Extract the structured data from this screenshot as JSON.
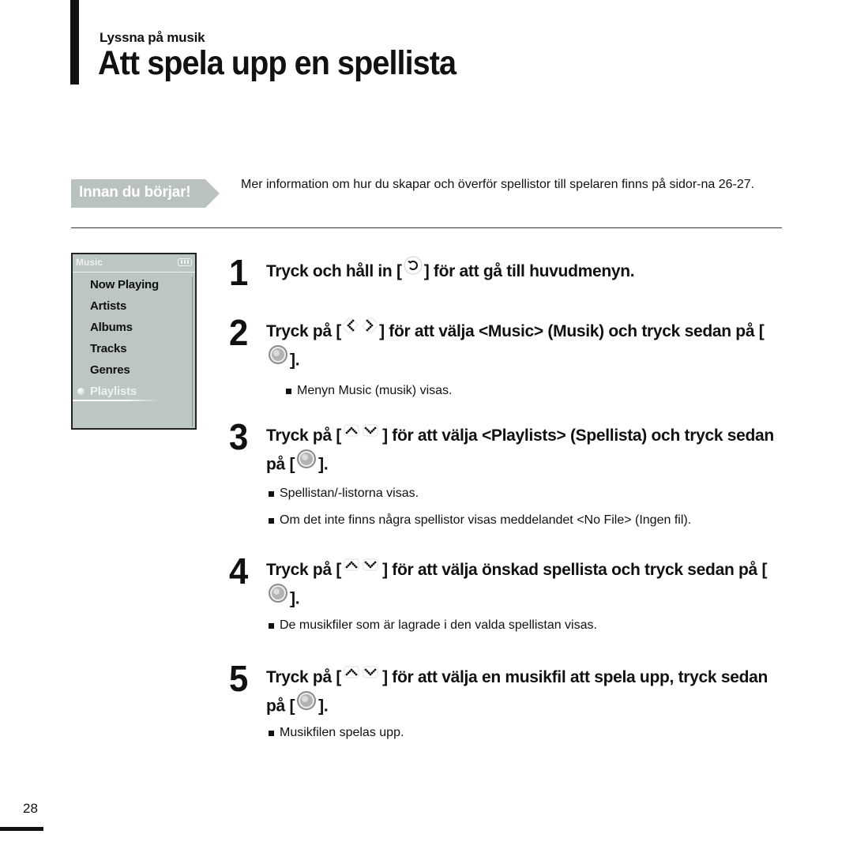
{
  "header": {
    "section": "Lyssna på musik",
    "title": "Att spela upp en spellista"
  },
  "note": {
    "badge": "Innan du börjar!",
    "text": "Mer information om hur du skapar och överför spellistor till spelaren finns på sidor-na 26-27."
  },
  "device_screen": {
    "title": "Music",
    "battery_icon": "battery-icon",
    "items": [
      "Now Playing",
      "Artists",
      "Albums",
      "Tracks",
      "Genres",
      "Playlists"
    ],
    "selected": "Playlists"
  },
  "steps": [
    {
      "number": "1",
      "parts": [
        "Tryck och håll in [",
        "back-icon",
        "] för att gå till huvudmenyn."
      ],
      "bullets": []
    },
    {
      "number": "2",
      "parts": [
        "Tryck på [",
        "left-right-icon",
        "] för att välja <Music> (Musik) och tryck sedan på [",
        "select-button-icon",
        "]."
      ],
      "bullets": [
        "Menyn Music (musik) visas."
      ]
    },
    {
      "number": "3",
      "parts": [
        "Tryck på [",
        "up-down-icon",
        "] för att välja <Playlists> (Spellista) och tryck sedan på [",
        "select-button-icon",
        "]."
      ],
      "bullets": [
        "Spellistan/-listorna visas.",
        "Om det inte finns några spellistor visas meddelandet <No File> (Ingen fil)."
      ]
    },
    {
      "number": "4",
      "parts": [
        "Tryck på [",
        "up-down-icon",
        "] för att välja önskad spellista och tryck sedan på [",
        "select-button-icon",
        "]."
      ],
      "bullets": [
        "De musikfiler som är lagrade i den valda spellistan visas."
      ]
    },
    {
      "number": "5",
      "parts": [
        "Tryck på [",
        "up-down-icon",
        "] för att välja en musikfil att spela upp, tryck sedan på [",
        "select-button-icon",
        "]."
      ],
      "bullets": [
        "Musikfilen spelas upp."
      ]
    }
  ],
  "page_number": "28"
}
